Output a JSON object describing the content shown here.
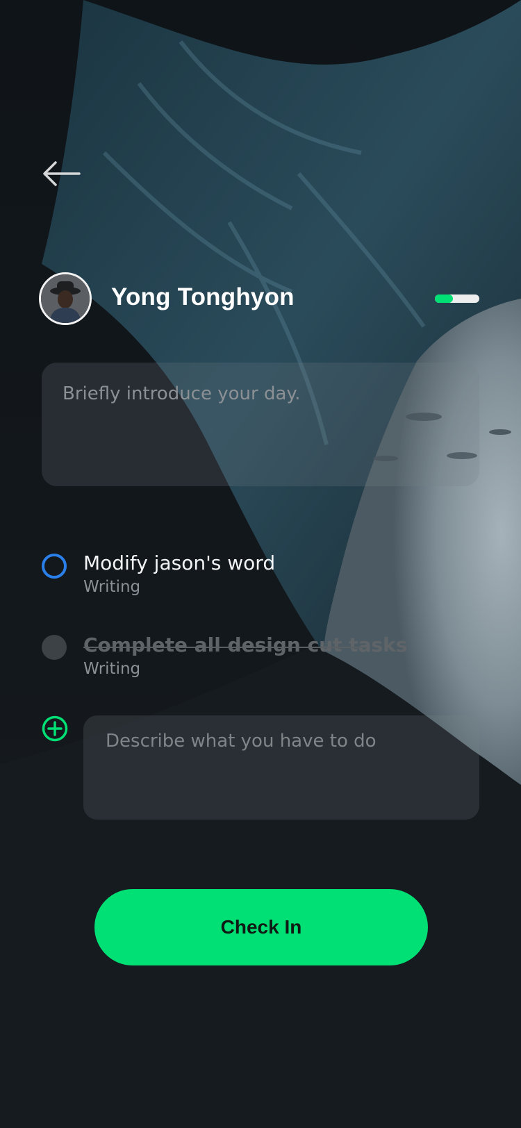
{
  "header": {
    "back_icon": "arrow-left-icon"
  },
  "user": {
    "name": "Yong Tonghyon",
    "toggle_level": 0.4,
    "toggle_color": "#00e074"
  },
  "intro": {
    "placeholder": "Briefly introduce your day."
  },
  "tasks": [
    {
      "title": "Modify jason's word",
      "category": "Writing",
      "done": false,
      "check_color": "#2a7fe8"
    },
    {
      "title": "Complete all design cut tasks",
      "category": "Writing",
      "done": true
    }
  ],
  "new_task": {
    "add_icon": "plus-circle-icon",
    "placeholder": "Describe what you have to do"
  },
  "actions": {
    "check_in_label": "Check In"
  },
  "colors": {
    "accent": "#00e074",
    "background": "#15191d"
  }
}
